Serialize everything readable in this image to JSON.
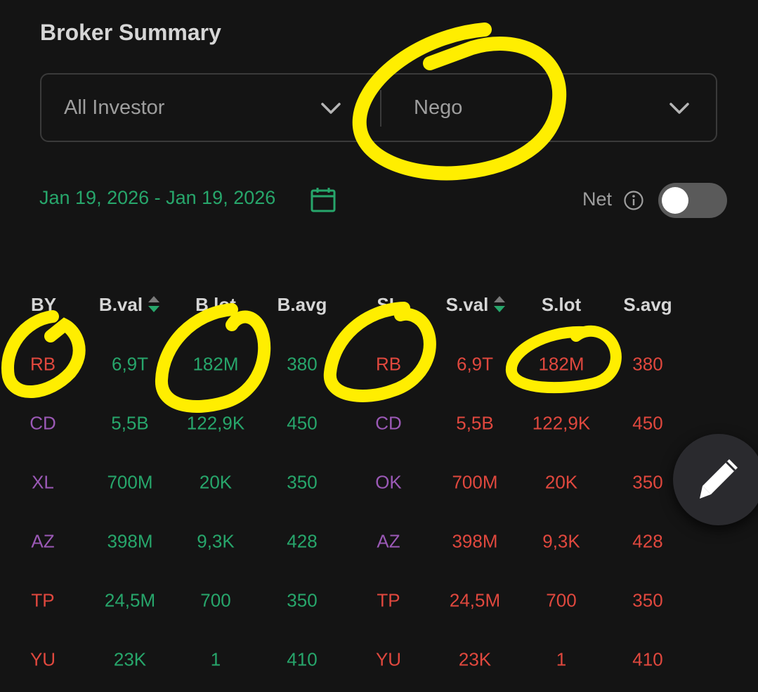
{
  "header": {
    "title": "Broker Summary"
  },
  "filters": {
    "investor": {
      "value": "All Investor",
      "icon": "chevron-down-icon"
    },
    "market": {
      "value": "Nego",
      "icon": "chevron-down-icon"
    }
  },
  "date": {
    "range": "Jan 19, 2026 - Jan 19, 2026",
    "icon": "calendar-icon"
  },
  "net": {
    "label": "Net",
    "info_icon": "info-icon",
    "enabled": false
  },
  "table": {
    "columns": [
      "BY",
      "B.val",
      "B.lot",
      "B.avg",
      "SL",
      "S.val",
      "S.lot",
      "S.avg"
    ],
    "sortable_columns": [
      "B.val",
      "S.val"
    ],
    "rows": [
      {
        "by": "RB",
        "by_color": "red",
        "bval": "6,9T",
        "blot": "182M",
        "bavg": "380",
        "sl": "RB",
        "sl_color": "red",
        "sval": "6,9T",
        "slot": "182M",
        "savg": "380"
      },
      {
        "by": "CD",
        "by_color": "purple",
        "bval": "5,5B",
        "blot": "122,9K",
        "bavg": "450",
        "sl": "CD",
        "sl_color": "purple",
        "sval": "5,5B",
        "slot": "122,9K",
        "savg": "450"
      },
      {
        "by": "XL",
        "by_color": "purple",
        "bval": "700M",
        "blot": "20K",
        "bavg": "350",
        "sl": "OK",
        "sl_color": "purple",
        "sval": "700M",
        "slot": "20K",
        "savg": "350"
      },
      {
        "by": "AZ",
        "by_color": "purple",
        "bval": "398M",
        "blot": "9,3K",
        "bavg": "428",
        "sl": "AZ",
        "sl_color": "purple",
        "sval": "398M",
        "slot": "9,3K",
        "savg": "428"
      },
      {
        "by": "TP",
        "by_color": "red",
        "bval": "24,5M",
        "blot": "700",
        "bavg": "350",
        "sl": "TP",
        "sl_color": "red",
        "sval": "24,5M",
        "slot": "700",
        "savg": "350"
      },
      {
        "by": "YU",
        "by_color": "red",
        "bval": "23K",
        "blot": "1",
        "bavg": "410",
        "sl": "YU",
        "sl_color": "red",
        "sval": "23K",
        "slot": "1",
        "savg": "410"
      }
    ]
  },
  "fab": {
    "icon": "pencil-icon"
  },
  "colors": {
    "buy": "#27a66b",
    "sell": "#e0483e",
    "broker_purple": "#9b59b6",
    "highlight": "#ffee00",
    "background": "#141414"
  }
}
